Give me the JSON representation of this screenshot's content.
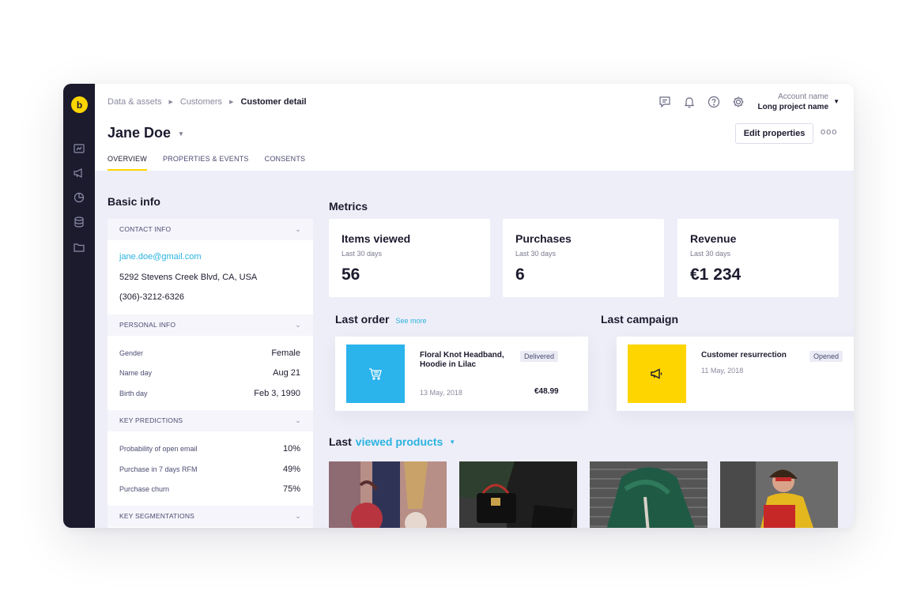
{
  "breadcrumb": {
    "items": [
      "Data & assets",
      "Customers"
    ],
    "current": "Customer detail"
  },
  "customer": {
    "name": "Jane Doe"
  },
  "tabs": [
    {
      "label": "OVERVIEW",
      "active": true
    },
    {
      "label": "PROPERTIES & EVENTS",
      "active": false
    },
    {
      "label": "CONSENTS",
      "active": false
    }
  ],
  "header": {
    "account_label": "Account name",
    "project": "Long project name",
    "edit_label": "Edit properties",
    "more_label": "ooo"
  },
  "icons": {
    "sidebar": [
      "dashboard-icon",
      "megaphone-icon",
      "pie-chart-icon",
      "database-icon",
      "folder-icon"
    ],
    "top": [
      "chat-icon",
      "bell-icon",
      "help-icon",
      "gear-icon"
    ]
  },
  "basic_info": {
    "title": "Basic info",
    "contact": {
      "header": "CONTACT INFO",
      "email": "jane.doe@gmail.com",
      "address": "5292 Stevens Creek Blvd, CA, USA",
      "phone": "(306)-3212-6326"
    },
    "personal": {
      "header": "PERSONAL INFO",
      "rows": [
        {
          "key": "Gender",
          "value": "Female"
        },
        {
          "key": "Name day",
          "value": "Aug 21"
        },
        {
          "key": "Birth day",
          "value": "Feb 3, 1990"
        }
      ]
    },
    "predictions": {
      "header": "KEY PREDICTIONS",
      "rows": [
        {
          "key": "Probability of open email",
          "value": "10%"
        },
        {
          "key": "Purchase in 7 days RFM",
          "value": "49%"
        },
        {
          "key": "Purchase churn",
          "value": "75%"
        }
      ]
    },
    "segmentations": {
      "header": "KEY SEGMENTATIONS"
    }
  },
  "metrics": {
    "title": "Metrics",
    "cards": [
      {
        "title": "Items viewed",
        "sub": "Last 30 days",
        "value": "56"
      },
      {
        "title": "Purchases",
        "sub": "Last 30 days",
        "value": "6"
      },
      {
        "title": "Revenue",
        "sub": "Last 30 days",
        "value": "€1 234"
      }
    ]
  },
  "last_order": {
    "title": "Last order",
    "see_more": "See more",
    "product": "Floral Knot Headband, Hoodie in Lilac",
    "status": "Delivered",
    "date": "13 May, 2018",
    "price": "€48.99",
    "thumb_color": "#2bb3ec"
  },
  "last_campaign": {
    "title": "Last campaign",
    "name": "Customer resurrection",
    "status": "Opened",
    "date": "11 May, 2018",
    "thumb_color": "#ffd500"
  },
  "viewed": {
    "prefix": "Last",
    "accent": "viewed products"
  },
  "colors": {
    "accent_blue": "#2bb3e0",
    "brand_yellow": "#ffd500",
    "sidebar": "#1c1b2e",
    "content_bg": "#eeeef8"
  }
}
